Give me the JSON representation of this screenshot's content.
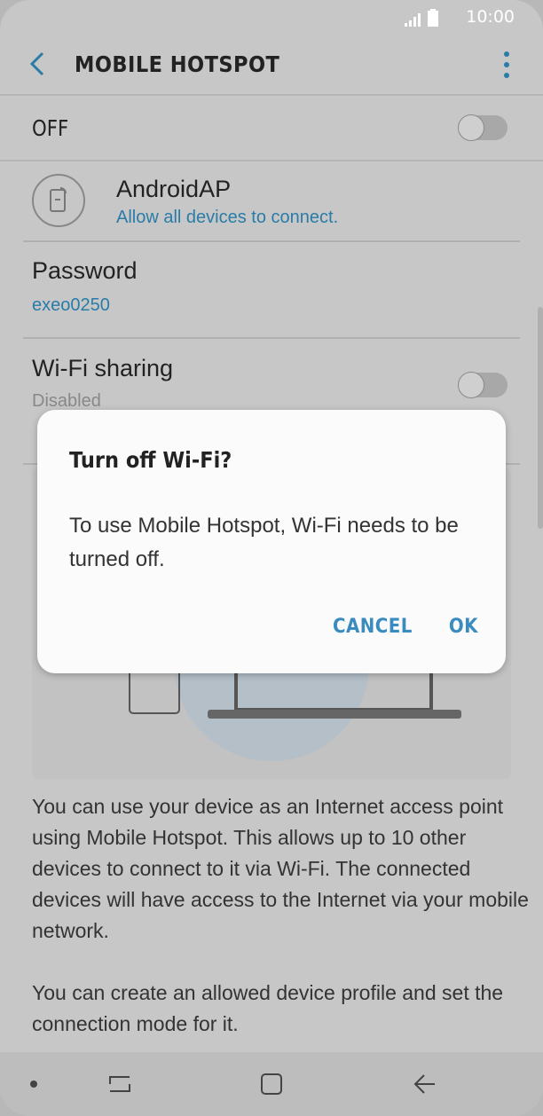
{
  "status_bar": {
    "time": "10:00"
  },
  "header": {
    "title": "MOBILE HOTSPOT"
  },
  "master_toggle": {
    "label": "OFF",
    "state": "off"
  },
  "network": {
    "name": "AndroidAP",
    "subtitle": "Allow all devices to connect."
  },
  "password": {
    "label": "Password",
    "value": "exeo0250"
  },
  "wifi_sharing": {
    "label": "Wi-Fi sharing",
    "status": "Disabled",
    "state": "off"
  },
  "description": {
    "p1": "You can use your device as an Internet access point using Mobile Hotspot. This allows up to 10 other devices to connect to it via Wi-Fi. The connected devices will have access to the Internet via your mobile network.",
    "p2": "You can create an allowed device profile and set the connection mode for it."
  },
  "dialog": {
    "title": "Turn off Wi-Fi?",
    "message": "To use Mobile Hotspot, Wi-Fi needs to be turned off.",
    "cancel_label": "CANCEL",
    "ok_label": "OK"
  },
  "icons": {
    "signal": "signal-icon",
    "battery": "battery-icon",
    "back": "back-arrow-icon",
    "more": "more-vert-icon",
    "hotspot": "hotspot-device-icon",
    "nav_dot": "dot-icon",
    "nav_recent": "recent-apps-icon",
    "nav_home": "home-icon",
    "nav_back": "nav-back-icon"
  },
  "colors": {
    "accent": "#3a8bbf",
    "link": "#2a7ca8",
    "dialog_bg": "#fbfbfb"
  }
}
